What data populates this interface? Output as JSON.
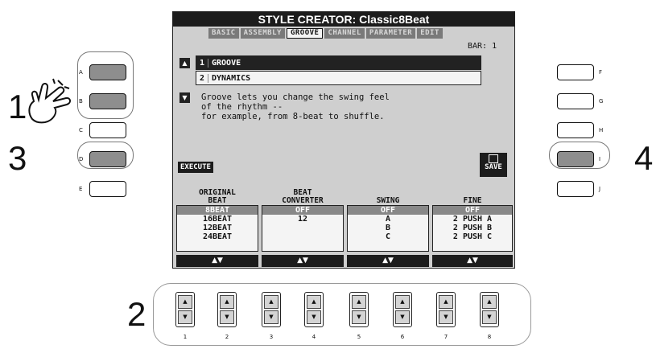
{
  "steps": [
    "1",
    "2",
    "3",
    "4"
  ],
  "lcd": {
    "title": "STYLE CREATOR: Classic8Beat",
    "tabs": [
      "BASIC",
      "ASSEMBLY",
      "GROOVE",
      "CHANNEL",
      "PARAMETER",
      "EDIT"
    ],
    "active_tab": "GROOVE",
    "bar_label": "BAR: 1",
    "menu_items": [
      {
        "num": "1",
        "label": "GROOVE"
      },
      {
        "num": "2",
        "label": "DYNAMICS"
      }
    ],
    "description": "Groove lets you change the swing feel\nof the rhythm --\nfor example, from 8-beat to shuffle.",
    "execute_label": "EXECUTE",
    "save_label": "SAVE",
    "params": [
      {
        "head": "ORIGINAL\nBEAT",
        "options": [
          "8BEAT",
          "16BEAT",
          "12BEAT",
          "24BEAT"
        ],
        "selected": 0
      },
      {
        "head": "BEAT\nCONVERTER",
        "options": [
          "OFF",
          "12"
        ],
        "selected": 0
      },
      {
        "head": "\nSWING",
        "options": [
          "OFF",
          "A",
          "B",
          "C"
        ],
        "selected": 0
      },
      {
        "head": "\nFINE",
        "options": [
          "OFF",
          "2 PUSH A",
          "2 PUSH B",
          "2 PUSH C"
        ],
        "selected": 0
      }
    ],
    "bottom_button_label": "▲▼"
  },
  "side_buttons": {
    "left": [
      "A",
      "B",
      "C",
      "D",
      "E"
    ],
    "right": [
      "F",
      "G",
      "H",
      "I",
      "J"
    ],
    "highlighted": [
      "A",
      "B",
      "D",
      "I"
    ]
  },
  "panel_buttons": [
    "1",
    "2",
    "3",
    "4",
    "5",
    "6",
    "7",
    "8"
  ],
  "panel_glyphs": {
    "up": "▲",
    "down": "▼"
  }
}
